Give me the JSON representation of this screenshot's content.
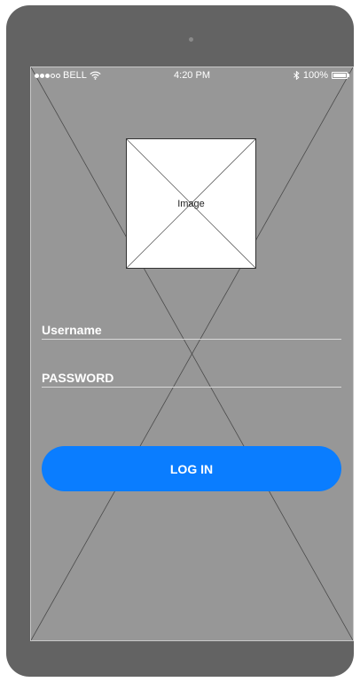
{
  "status_bar": {
    "carrier": "BELL",
    "time": "4:20 PM",
    "battery": "100%",
    "signal_strength": 3,
    "signal_max": 5
  },
  "image_placeholder": {
    "label": "Image"
  },
  "form": {
    "username_label": "Username",
    "password_label": "PASSWORD",
    "login_label": "LOG IN"
  },
  "colors": {
    "device_frame": "#636363",
    "screen_background": "#979797",
    "accent": "#0a7dff",
    "text_light": "#ffffff"
  },
  "icons": [
    "signal-dots-icon",
    "wifi-icon",
    "bluetooth-icon",
    "battery-icon",
    "image-placeholder-icon"
  ]
}
